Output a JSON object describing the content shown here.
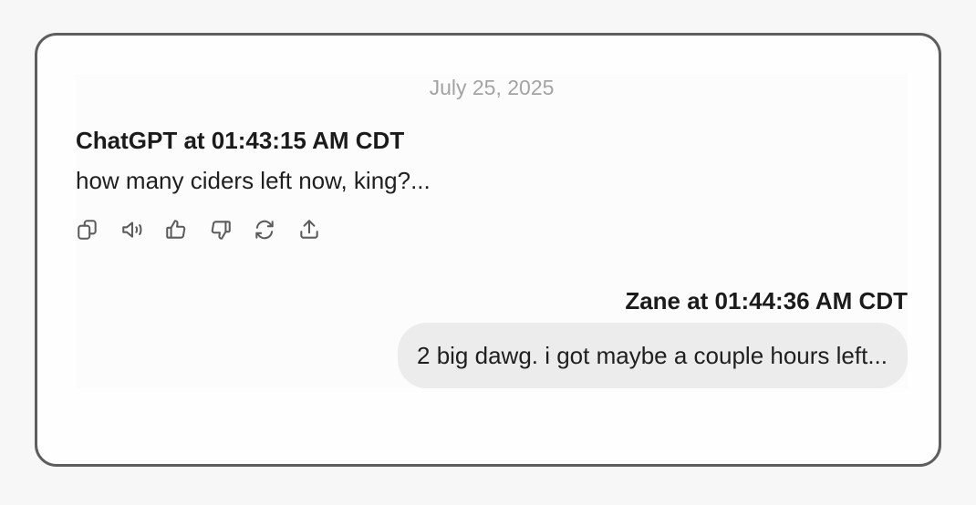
{
  "conversation": {
    "date": "July 25, 2025",
    "assistant_message": {
      "header": "ChatGPT at 01:43:15 AM CDT",
      "text": "how many ciders left now, king?..."
    },
    "message_actions": [
      {
        "name": "copy",
        "icon": "copy-icon"
      },
      {
        "name": "read-aloud",
        "icon": "speaker-icon"
      },
      {
        "name": "good-response",
        "icon": "thumbs-up-icon"
      },
      {
        "name": "bad-response",
        "icon": "thumbs-down-icon"
      },
      {
        "name": "regenerate",
        "icon": "refresh-icon"
      },
      {
        "name": "share",
        "icon": "share-icon"
      }
    ],
    "user_message": {
      "header": "Zane at 01:44:36 AM CDT",
      "text": "2 big dawg. i got maybe a couple hours left..."
    }
  }
}
